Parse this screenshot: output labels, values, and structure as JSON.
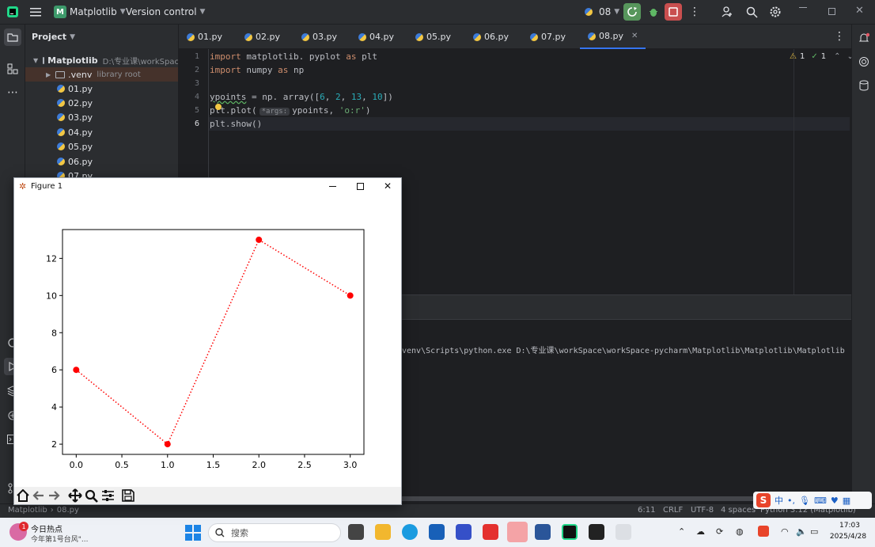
{
  "titlebar": {
    "project_badge": "M",
    "project_name": "Matplotlib",
    "vcs": "Version control",
    "python_version": "08"
  },
  "project_panel": {
    "header": "Project",
    "root_name": "Matplotlib",
    "root_path": "D:\\专业课\\workSpace\\w",
    "venv": ".venv",
    "venv_note": "library root",
    "files": [
      "01.py",
      "02.py",
      "03.py",
      "04.py",
      "05.py",
      "06.py",
      "07.py"
    ]
  },
  "tabs": [
    "01.py",
    "02.py",
    "03.py",
    "04.py",
    "05.py",
    "06.py",
    "07.py",
    "08.py"
  ],
  "editor": {
    "warnings": "1",
    "checks": "1",
    "line_numbers": [
      "1",
      "2",
      "3",
      "4",
      "5",
      "6"
    ],
    "lines": {
      "l1_kw1": "import",
      "l1_mod": " matplotlib. pyplot ",
      "l1_kw2": "as",
      "l1_alias": " plt",
      "l2_kw1": "import",
      "l2_mod": " numpy ",
      "l2_kw2": "as",
      "l2_alias": " np",
      "l4_a": "ypoints",
      "l4_b": " = np. array([",
      "l4_n1": "6",
      "l4_c1": ", ",
      "l4_n2": "2",
      "l4_c2": ", ",
      "l4_n3": "13",
      "l4_c3": ", ",
      "l4_n4": "10",
      "l4_end": "])",
      "l5_a": "plt.plot(",
      "l5_hint": "*args:",
      "l5_b": "ypoints, ",
      "l5_str": "'o:r'",
      "l5_end": ")",
      "l6": "plt.show()"
    }
  },
  "run": {
    "command": "venv\\Scripts\\python.exe D:\\专业课\\workSpace\\workSpace-pycharm\\Matplotlib\\Matplotlib\\Matplotlib"
  },
  "statusbar": {
    "crumb1": "Matplotlib",
    "crumb2": "08.py",
    "position": "6:11",
    "line_sep": "CRLF",
    "encoding": "UTF-8",
    "indent": "4 spaces",
    "interpreter": "Python 3.12 (Matplotlib)"
  },
  "figure": {
    "title": "Figure 1"
  },
  "chart_data": {
    "type": "line",
    "x": [
      0,
      1,
      2,
      3
    ],
    "values": [
      6,
      2,
      13,
      10
    ],
    "style": "dotted line with circle markers",
    "color": "#ff0000",
    "xlim": [
      -0.15,
      3.15
    ],
    "ylim": [
      1.45,
      13.55
    ],
    "xticks": [
      "0.0",
      "0.5",
      "1.0",
      "1.5",
      "2.0",
      "2.5",
      "3.0"
    ],
    "yticks": [
      "2",
      "4",
      "6",
      "8",
      "10",
      "12"
    ]
  },
  "taskbar": {
    "news_badge": "1",
    "news_title": "今日热点",
    "news_sub": "今年第1号台风\"...",
    "search_placeholder": "搜索",
    "time": "17:03",
    "date": "2025/4/28"
  },
  "ime": {
    "lang": "中"
  }
}
